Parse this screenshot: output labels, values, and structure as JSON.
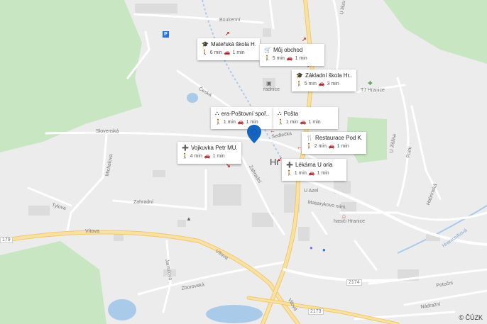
{
  "streets": {
    "boukenni": "Boukenní",
    "ceska": "Česká",
    "slovenska": "Slovenská",
    "sedlecka": "Sedlečka",
    "michalova": "Michalova",
    "tylova": "Tylova",
    "zahradni": "Zahradní",
    "zahradni2": "Zahradní",
    "vitova_w": "Vítova",
    "vitova_e": "Vítova",
    "jarmilova": "Jarmilova",
    "zborovska": "Zborovská",
    "vilova": "Vilová",
    "masarykovo": "Masarykovo nám.",
    "ulazu": "U lázu",
    "ujsilina": "U Jíšlina",
    "polni": "Polní",
    "habrinska": "Habrinská",
    "nadrazni": "Nádražní",
    "potocni": "Potoční",
    "hranicnikova": "Hranicníková",
    "radnice": "radnice",
    "tj": "TJ Hranice",
    "hasici": "hasiči Hranice",
    "uazel": "U Azel",
    "road_2174": "2174",
    "road_2173": "2173",
    "road_179": "179",
    "town": "Hr"
  },
  "places": [
    {
      "name": "Mateřská škola H...",
      "icon": "school-icon",
      "walk": "6 min",
      "drive": "1 min"
    },
    {
      "name": "Můj obchod",
      "icon": "shop-icon",
      "walk": "5 min",
      "drive": "1 min"
    },
    {
      "name": "Základní škola Hr...",
      "icon": "school-icon",
      "walk": "5 min",
      "drive": "3 min"
    },
    {
      "name": "era-Poštovní spoř...",
      "icon": "bank-icon",
      "walk": "1 min",
      "drive": "1 min"
    },
    {
      "name": "Pošta",
      "icon": "post-icon",
      "walk": "1 min",
      "drive": "1 min"
    },
    {
      "name": "Restaurace Pod K...",
      "icon": "restaurant-icon",
      "walk": "2 min",
      "drive": "1 min"
    },
    {
      "name": "Vojkuvka Petr MU...",
      "icon": "medical-icon",
      "walk": "4 min",
      "drive": "1 min"
    },
    {
      "name": "Lékárna U orla",
      "icon": "medical-icon",
      "walk": "1 min",
      "drive": "1 min"
    }
  ],
  "copyright": "© ČÚZK",
  "colors": {
    "background": "#ececec",
    "forest": "#c8e6c2",
    "water": "#a9cbe9",
    "road_main": "#f9e0a4",
    "road_main_edge": "#f0c96a",
    "road_minor": "#ffffff",
    "building": "#dcdcdc",
    "pin": "#1565c0",
    "arrow": "#c62828"
  }
}
